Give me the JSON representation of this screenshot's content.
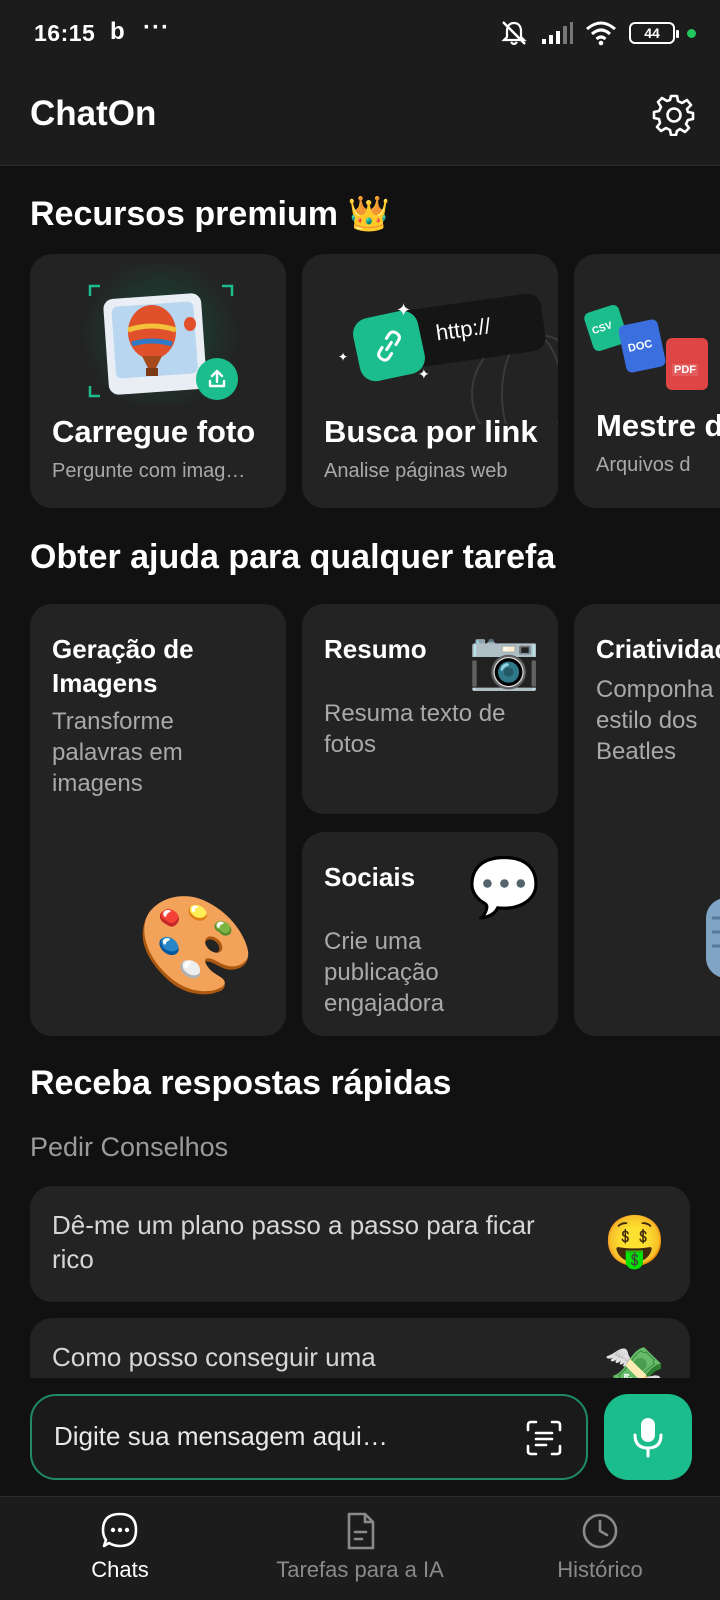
{
  "status_bar": {
    "time": "16:15",
    "b_glyph": "b",
    "more": "···",
    "battery": "44"
  },
  "header": {
    "title": "ChatOn"
  },
  "premium": {
    "title": "Recursos premium 👑",
    "cards": [
      {
        "title": "Carregue foto",
        "subtitle": "Pergunte com imag…"
      },
      {
        "title": "Busca por link",
        "subtitle": "Analise páginas web",
        "link_text": "http://"
      },
      {
        "title": "Mestre d",
        "subtitle": "Arquivos d",
        "badges": [
          "CSV",
          "DOC",
          "PDF"
        ]
      }
    ]
  },
  "tasks": {
    "title": "Obter ajuda para qualquer tarefa",
    "cards": [
      {
        "title": "Geração de Imagens",
        "subtitle": "Transforme palavras em imagens",
        "emoji": "🎨"
      },
      {
        "title": "Resumo",
        "subtitle": "Resuma texto de fotos",
        "emoji": "📷"
      },
      {
        "title": "Sociais",
        "subtitle": "Crie uma publicação engajadora",
        "emoji": "💬"
      },
      {
        "title": "Criatividade",
        "subtitle": "Componha no estilo dos Beatles"
      }
    ]
  },
  "quick": {
    "title": "Receba respostas rápidas",
    "category": "Pedir Conselhos",
    "items": [
      {
        "text": "Dê-me um plano passo a passo para ficar rico",
        "emoji": "🤑"
      },
      {
        "text": "Como posso conseguir uma",
        "emoji": "💸"
      }
    ]
  },
  "input": {
    "placeholder": "Digite sua mensagem aqui…"
  },
  "nav": [
    {
      "label": "Chats",
      "active": true
    },
    {
      "label": "Tarefas para a IA",
      "active": false
    },
    {
      "label": "Histórico",
      "active": false
    }
  ],
  "colors": {
    "accent": "#1bbd8c",
    "background": "#111111",
    "card": "#232323",
    "muted_text": "#a9a9a9"
  }
}
